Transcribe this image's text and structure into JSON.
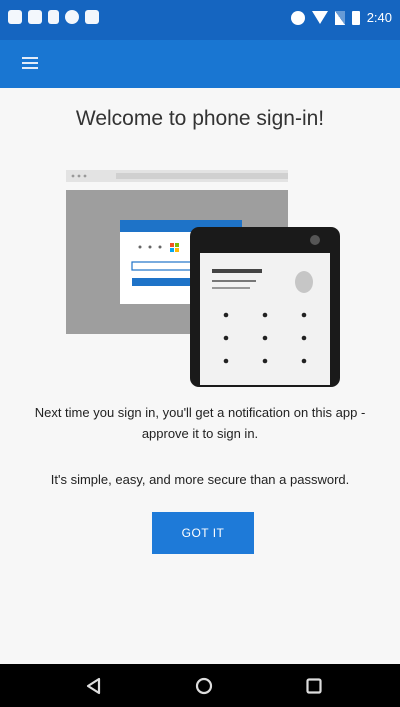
{
  "status_bar": {
    "time": "2:40",
    "left_icons": [
      "wifi-notification-icon",
      "message-icon",
      "sim-icon",
      "chat-icon",
      "camera-icon"
    ],
    "right_icons": [
      "do-not-disturb-icon",
      "wifi-icon",
      "signal-icon",
      "battery-icon"
    ]
  },
  "app_bar": {
    "menu_icon": "hamburger-menu-icon",
    "color": "#1976d2"
  },
  "main": {
    "title": "Welcome to phone sign-in!",
    "description": "Next time you sign in, you'll get a notification on this app - approve it to sign in.",
    "secondary": "It's simple, easy, and more secure than a password.",
    "button_label": "GOT IT",
    "illustration": "phone-and-browser-illustration"
  },
  "nav_bar": {
    "buttons": [
      "back-icon",
      "home-icon",
      "recents-icon"
    ]
  },
  "colors": {
    "status_bar": "#1565c0",
    "accent": "#1e7ad8",
    "background": "#f7f7f7"
  }
}
